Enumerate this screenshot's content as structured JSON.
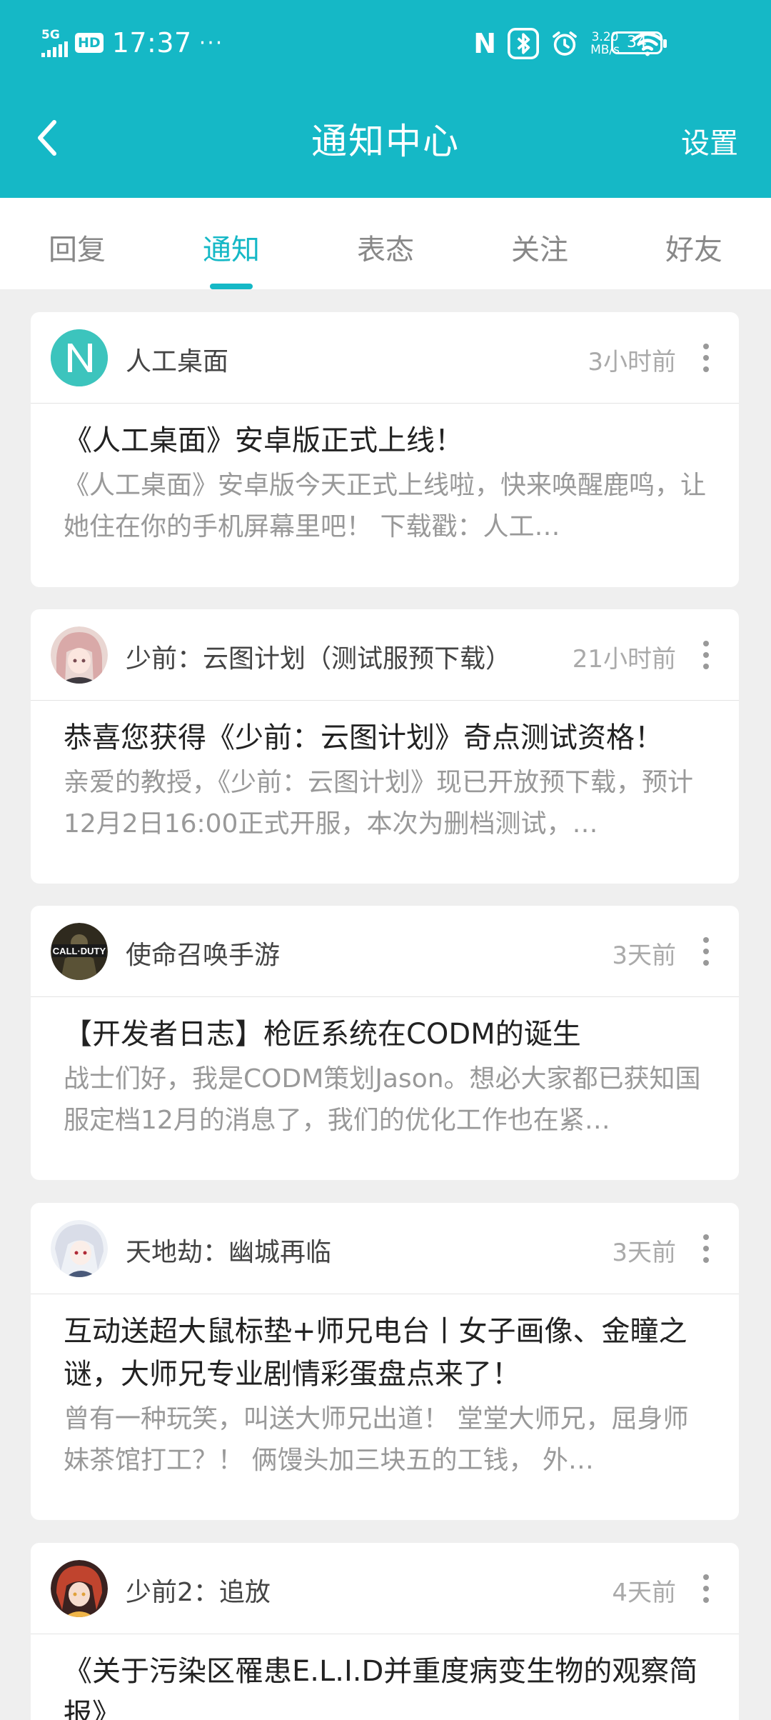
{
  "status_bar": {
    "network": "5G",
    "hd_label": "HD",
    "time": "17:37",
    "more_dots": "···",
    "nfc": "N",
    "speed_value": "3.20",
    "speed_unit": "MB/s",
    "battery": "34"
  },
  "header": {
    "title": "通知中心",
    "settings_label": "设置"
  },
  "tabs": [
    {
      "label": "回复",
      "active": false
    },
    {
      "label": "通知",
      "active": true
    },
    {
      "label": "表态",
      "active": false
    },
    {
      "label": "关注",
      "active": false
    },
    {
      "label": "好友",
      "active": false
    }
  ],
  "accent_color": "#15b8c6",
  "notifications": [
    {
      "source": "人工桌面",
      "time": "3小时前",
      "avatar_icon": "letter-n-logo",
      "title": "《人工桌面》安卓版正式上线！",
      "excerpt": "《人工桌面》安卓版今天正式上线啦，快来唤醒鹿鸣，让她住在你的手机屏幕里吧！ 下载戳：人工…"
    },
    {
      "source": "少前：云图计划（测试服预下载）",
      "time": "21小时前",
      "avatar_icon": "anime-girl-avatar",
      "title": "恭喜您获得《少前：云图计划》奇点测试资格！",
      "excerpt": "亲爱的教授，《少前：云图计划》现已开放预下载，预计12月2日16:00正式开服，本次为删档测试，…"
    },
    {
      "source": "使命召唤手游",
      "time": "3天前",
      "avatar_icon": "call-of-duty-avatar",
      "avatar_text": "CALL·DUTY",
      "title": "【开发者日志】枪匠系统在CODM的诞生",
      "excerpt": "战士们好，我是CODM策划Jason。想必大家都已获知国服定档12月的消息了，我们的优化工作也在紧…"
    },
    {
      "source": "天地劫：幽城再临",
      "time": "3天前",
      "avatar_icon": "white-hair-character-avatar",
      "title": "互动送超大鼠标垫+师兄电台丨女子画像、金瞳之谜，大师兄专业剧情彩蛋盘点来了！",
      "excerpt": "曾有一种玩笑，叫送大师兄出道！ 堂堂大师兄，屈身师妹茶馆打工？！ 俩馒头加三块五的工钱， 外…"
    },
    {
      "source": "少前2：追放",
      "time": "4天前",
      "avatar_icon": "red-hair-character-avatar",
      "title": "《关于污染区罹患E.L.I.D并重度病变生物的观察简报》",
      "excerpt": ""
    }
  ]
}
